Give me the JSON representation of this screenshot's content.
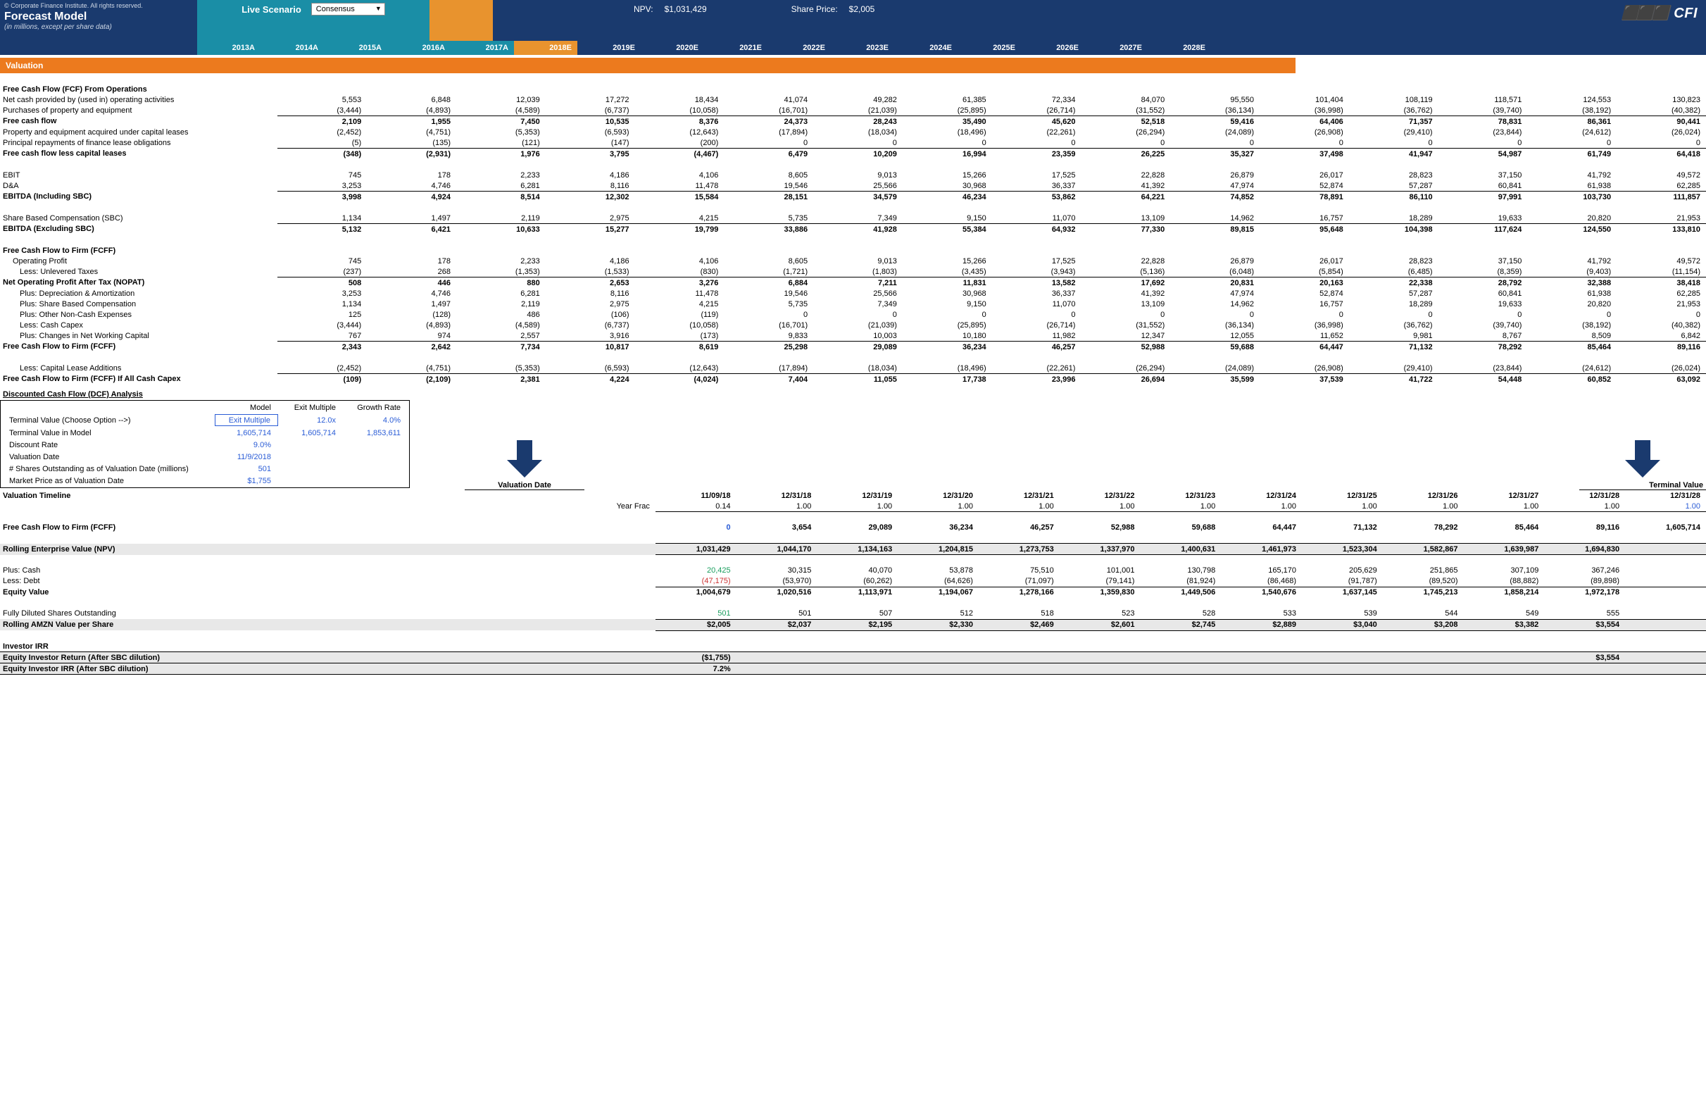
{
  "header": {
    "copyright": "© Corporate Finance Institute. All rights reserved.",
    "title": "Forecast Model",
    "subtitle": "(in millions, except per share data)",
    "live_scenario_label": "Live Scenario",
    "dropdown_value": "Consensus",
    "npv_label": "NPV:",
    "npv_value": "$1,031,429",
    "share_price_label": "Share Price:",
    "share_price_value": "$2,005",
    "logo": "CFI"
  },
  "years": [
    "2013A",
    "2014A",
    "2015A",
    "2016A",
    "2017A",
    "2018E",
    "2019E",
    "2020E",
    "2021E",
    "2022E",
    "2023E",
    "2024E",
    "2025E",
    "2026E",
    "2027E",
    "2028E"
  ],
  "section_valuation": "Valuation",
  "fcf_ops_title": "Free Cash Flow (FCF) From Operations",
  "rows_top": [
    {
      "label": "Net cash provided by (used in) operating activities",
      "vals": [
        "5,553",
        "6,848",
        "12,039",
        "17,272",
        "18,434",
        "41,074",
        "49,282",
        "61,385",
        "72,334",
        "84,070",
        "95,550",
        "101,404",
        "108,119",
        "118,571",
        "124,553",
        "130,823"
      ]
    },
    {
      "label": "Purchases of property and equipment",
      "vals": [
        "(3,444)",
        "(4,893)",
        "(4,589)",
        "(6,737)",
        "(10,058)",
        "(16,701)",
        "(21,039)",
        "(25,895)",
        "(26,714)",
        "(31,552)",
        "(36,134)",
        "(36,998)",
        "(36,762)",
        "(39,740)",
        "(38,192)",
        "(40,382)"
      ],
      "bb": true
    },
    {
      "label": "Free cash flow",
      "vals": [
        "2,109",
        "1,955",
        "7,450",
        "10,535",
        "8,376",
        "24,373",
        "28,243",
        "35,490",
        "45,620",
        "52,518",
        "59,416",
        "64,406",
        "71,357",
        "78,831",
        "86,361",
        "90,441"
      ],
      "bold": true
    },
    {
      "label": "Property and equipment acquired under capital leases",
      "vals": [
        "(2,452)",
        "(4,751)",
        "(5,353)",
        "(6,593)",
        "(12,643)",
        "(17,894)",
        "(18,034)",
        "(18,496)",
        "(22,261)",
        "(26,294)",
        "(24,089)",
        "(26,908)",
        "(29,410)",
        "(23,844)",
        "(24,612)",
        "(26,024)"
      ]
    },
    {
      "label": "Principal repayments of finance lease obligations",
      "vals": [
        "(5)",
        "(135)",
        "(121)",
        "(147)",
        "(200)",
        "0",
        "0",
        "0",
        "0",
        "0",
        "0",
        "0",
        "0",
        "0",
        "0",
        "0"
      ],
      "bb": true
    },
    {
      "label": "Free cash flow less capital leases",
      "vals": [
        "(348)",
        "(2,931)",
        "1,976",
        "3,795",
        "(4,467)",
        "6,479",
        "10,209",
        "16,994",
        "23,359",
        "26,225",
        "35,327",
        "37,498",
        "41,947",
        "54,987",
        "61,749",
        "64,418"
      ],
      "bold": true
    }
  ],
  "rows_ebit": [
    {
      "label": "EBIT",
      "vals": [
        "745",
        "178",
        "2,233",
        "4,186",
        "4,106",
        "8,605",
        "9,013",
        "15,266",
        "17,525",
        "22,828",
        "26,879",
        "26,017",
        "28,823",
        "37,150",
        "41,792",
        "49,572"
      ]
    },
    {
      "label": "D&A",
      "vals": [
        "3,253",
        "4,746",
        "6,281",
        "8,116",
        "11,478",
        "19,546",
        "25,566",
        "30,968",
        "36,337",
        "41,392",
        "47,974",
        "52,874",
        "57,287",
        "60,841",
        "61,938",
        "62,285"
      ],
      "bb": true
    },
    {
      "label": "EBITDA (Including SBC)",
      "vals": [
        "3,998",
        "4,924",
        "8,514",
        "12,302",
        "15,584",
        "28,151",
        "34,579",
        "46,234",
        "53,862",
        "64,221",
        "74,852",
        "78,891",
        "86,110",
        "97,991",
        "103,730",
        "111,857"
      ],
      "bold": true
    }
  ],
  "rows_sbc": [
    {
      "label": "Share Based Compensation (SBC)",
      "vals": [
        "1,134",
        "1,497",
        "2,119",
        "2,975",
        "4,215",
        "5,735",
        "7,349",
        "9,150",
        "11,070",
        "13,109",
        "14,962",
        "16,757",
        "18,289",
        "19,633",
        "20,820",
        "21,953"
      ],
      "bb": true
    },
    {
      "label": "EBITDA (Excluding SBC)",
      "vals": [
        "5,132",
        "6,421",
        "10,633",
        "15,277",
        "19,799",
        "33,886",
        "41,928",
        "55,384",
        "64,932",
        "77,330",
        "89,815",
        "95,648",
        "104,398",
        "117,624",
        "124,550",
        "133,810"
      ],
      "bold": true
    }
  ],
  "fcff_title": "Free Cash Flow to Firm (FCFF)",
  "rows_fcff": [
    {
      "label": "Operating Profit",
      "indent": 1,
      "vals": [
        "745",
        "178",
        "2,233",
        "4,186",
        "4,106",
        "8,605",
        "9,013",
        "15,266",
        "17,525",
        "22,828",
        "26,879",
        "26,017",
        "28,823",
        "37,150",
        "41,792",
        "49,572"
      ]
    },
    {
      "label": "Less: Unlevered Taxes",
      "indent": 2,
      "vals": [
        "(237)",
        "268",
        "(1,353)",
        "(1,533)",
        "(830)",
        "(1,721)",
        "(1,803)",
        "(3,435)",
        "(3,943)",
        "(5,136)",
        "(6,048)",
        "(5,854)",
        "(6,485)",
        "(8,359)",
        "(9,403)",
        "(11,154)"
      ],
      "bb": true
    },
    {
      "label": "Net Operating Profit After Tax (NOPAT)",
      "vals": [
        "508",
        "446",
        "880",
        "2,653",
        "3,276",
        "6,884",
        "7,211",
        "11,831",
        "13,582",
        "17,692",
        "20,831",
        "20,163",
        "22,338",
        "28,792",
        "32,388",
        "38,418"
      ],
      "bold": true
    },
    {
      "label": "Plus: Depreciation & Amortization",
      "indent": 2,
      "vals": [
        "3,253",
        "4,746",
        "6,281",
        "8,116",
        "11,478",
        "19,546",
        "25,566",
        "30,968",
        "36,337",
        "41,392",
        "47,974",
        "52,874",
        "57,287",
        "60,841",
        "61,938",
        "62,285"
      ]
    },
    {
      "label": "Plus: Share Based Compensation",
      "indent": 2,
      "vals": [
        "1,134",
        "1,497",
        "2,119",
        "2,975",
        "4,215",
        "5,735",
        "7,349",
        "9,150",
        "11,070",
        "13,109",
        "14,962",
        "16,757",
        "18,289",
        "19,633",
        "20,820",
        "21,953"
      ]
    },
    {
      "label": "Plus: Other Non-Cash Expenses",
      "indent": 2,
      "vals": [
        "125",
        "(128)",
        "486",
        "(106)",
        "(119)",
        "0",
        "0",
        "0",
        "0",
        "0",
        "0",
        "0",
        "0",
        "0",
        "0",
        "0"
      ]
    },
    {
      "label": "Less: Cash Capex",
      "indent": 2,
      "vals": [
        "(3,444)",
        "(4,893)",
        "(4,589)",
        "(6,737)",
        "(10,058)",
        "(16,701)",
        "(21,039)",
        "(25,895)",
        "(26,714)",
        "(31,552)",
        "(36,134)",
        "(36,998)",
        "(36,762)",
        "(39,740)",
        "(38,192)",
        "(40,382)"
      ]
    },
    {
      "label": "Plus: Changes in Net Working Capital",
      "indent": 2,
      "vals": [
        "767",
        "974",
        "2,557",
        "3,916",
        "(173)",
        "9,833",
        "10,003",
        "10,180",
        "11,982",
        "12,347",
        "12,055",
        "11,652",
        "9,981",
        "8,767",
        "8,509",
        "6,842"
      ],
      "bb": true
    },
    {
      "label": "Free Cash Flow to Firm (FCFF)",
      "vals": [
        "2,343",
        "2,642",
        "7,734",
        "10,817",
        "8,619",
        "25,298",
        "29,089",
        "36,234",
        "46,257",
        "52,988",
        "59,688",
        "64,447",
        "71,132",
        "78,292",
        "85,464",
        "89,116"
      ],
      "bold": true
    }
  ],
  "rows_fcff2": [
    {
      "label": "Less: Capital Lease Additions",
      "indent": 2,
      "vals": [
        "(2,452)",
        "(4,751)",
        "(5,353)",
        "(6,593)",
        "(12,643)",
        "(17,894)",
        "(18,034)",
        "(18,496)",
        "(22,261)",
        "(26,294)",
        "(24,089)",
        "(26,908)",
        "(29,410)",
        "(23,844)",
        "(24,612)",
        "(26,024)"
      ],
      "bb": true
    },
    {
      "label": "Free Cash Flow to Firm (FCFF) If All Cash Capex",
      "vals": [
        "(109)",
        "(2,109)",
        "2,381",
        "4,224",
        "(4,024)",
        "7,404",
        "11,055",
        "17,738",
        "23,996",
        "26,694",
        "35,599",
        "37,539",
        "41,722",
        "54,448",
        "60,852",
        "63,092"
      ],
      "bold": true
    }
  ],
  "dcf_title": "Discounted Cash Flow (DCF) Analysis",
  "dcf_box": {
    "hdr": [
      "",
      "Model",
      "Exit Multiple",
      "Growth Rate"
    ],
    "rows": [
      {
        "label": "Terminal Value (Choose Option -->)",
        "vals": [
          "Exit Multiple",
          "12.0x",
          "4.0%"
        ],
        "box": true
      },
      {
        "label": "Terminal Value in Model",
        "vals": [
          "1,605,714",
          "1,605,714",
          "1,853,611"
        ]
      },
      {
        "label": "Discount Rate",
        "vals": [
          "9.0%",
          "",
          ""
        ]
      },
      {
        "label": "Valuation Date",
        "vals": [
          "11/9/2018",
          "",
          ""
        ]
      },
      {
        "label": "# Shares Outstanding as of Valuation Date (millions)",
        "vals": [
          "501",
          "",
          ""
        ]
      },
      {
        "label": "Market Price as of Valuation Date",
        "vals": [
          "$1,755",
          "",
          ""
        ]
      }
    ]
  },
  "timeline": {
    "vd_label": "Valuation Date",
    "tv_label": "Terminal Value",
    "row_label": "Valuation Timeline",
    "dates": [
      "11/09/18",
      "12/31/18",
      "12/31/19",
      "12/31/20",
      "12/31/21",
      "12/31/22",
      "12/31/23",
      "12/31/24",
      "12/31/25",
      "12/31/26",
      "12/31/27",
      "12/31/28",
      "12/31/28"
    ],
    "yf_label": "Year Frac",
    "yf": [
      "0.14",
      "1.00",
      "1.00",
      "1.00",
      "1.00",
      "1.00",
      "1.00",
      "1.00",
      "1.00",
      "1.00",
      "1.00",
      "1.00",
      "1.00"
    ]
  },
  "fcff_line": {
    "label": "Free Cash Flow to Firm (FCFF)",
    "vals": [
      "0",
      "3,654",
      "29,089",
      "36,234",
      "46,257",
      "52,988",
      "59,688",
      "64,447",
      "71,132",
      "78,292",
      "85,464",
      "89,116",
      "1,605,714"
    ]
  },
  "npv_line": {
    "label": "Rolling Enterprise Value (NPV)",
    "vals": [
      "1,031,429",
      "1,044,170",
      "1,134,163",
      "1,204,815",
      "1,273,753",
      "1,337,970",
      "1,400,631",
      "1,461,973",
      "1,523,304",
      "1,582,867",
      "1,639,987",
      "1,694,830"
    ]
  },
  "cash": {
    "label": "Plus: Cash",
    "vals": [
      "20,425",
      "30,315",
      "40,070",
      "53,878",
      "75,510",
      "101,001",
      "130,798",
      "165,170",
      "205,629",
      "251,865",
      "307,109",
      "367,246"
    ]
  },
  "debt": {
    "label": "Less: Debt",
    "vals": [
      "(47,175)",
      "(53,970)",
      "(60,262)",
      "(64,626)",
      "(71,097)",
      "(79,141)",
      "(81,924)",
      "(86,468)",
      "(91,787)",
      "(89,520)",
      "(88,882)",
      "(89,898)"
    ]
  },
  "equity": {
    "label": "Equity Value",
    "vals": [
      "1,004,679",
      "1,020,516",
      "1,113,971",
      "1,194,067",
      "1,278,166",
      "1,359,830",
      "1,449,506",
      "1,540,676",
      "1,637,145",
      "1,745,213",
      "1,858,214",
      "1,972,178"
    ]
  },
  "shares": {
    "label": "Fully Diluted Shares Outstanding",
    "vals": [
      "501",
      "501",
      "507",
      "512",
      "518",
      "523",
      "528",
      "533",
      "539",
      "544",
      "549",
      "555"
    ]
  },
  "pershare": {
    "label": "Rolling AMZN Value per Share",
    "vals": [
      "$2,005",
      "$2,037",
      "$2,195",
      "$2,330",
      "$2,469",
      "$2,601",
      "$2,745",
      "$2,889",
      "$3,040",
      "$3,208",
      "$3,382",
      "$3,554"
    ]
  },
  "irr_title": "Investor IRR",
  "irr1": {
    "label": "Equity Investor Return (After SBC dilution)",
    "v1": "($1,755)",
    "v2": "$3,554"
  },
  "irr2": {
    "label": "Equity Investor IRR (After SBC dilution)",
    "v1": "7.2%"
  }
}
